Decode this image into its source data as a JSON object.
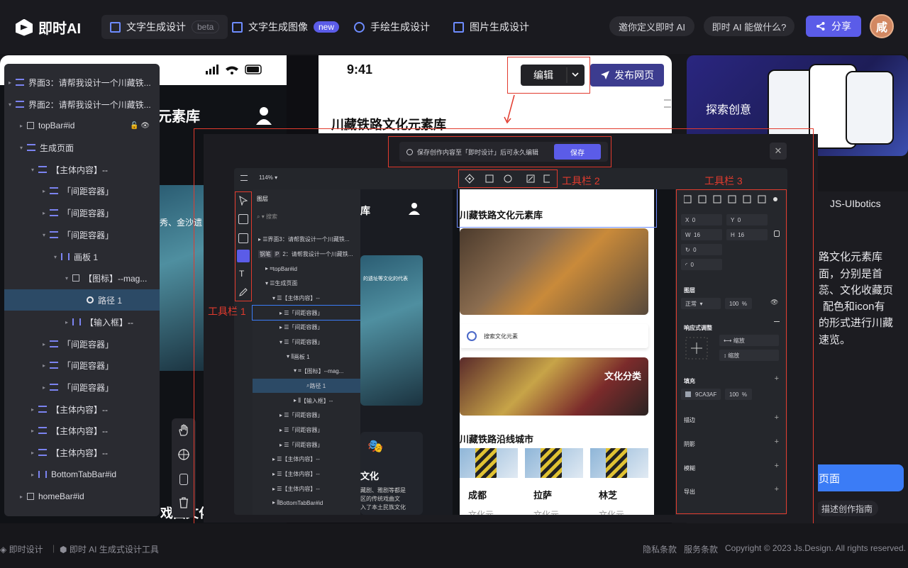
{
  "nav": {
    "brand": "即时AI",
    "tabs": [
      {
        "label": "文字生成设计",
        "badge": "beta"
      },
      {
        "label": "文字生成图像",
        "badge": "new"
      },
      {
        "label": "手绘生成设计"
      },
      {
        "label": "图片生成设计"
      }
    ],
    "invite": "邀你定义即时 AI",
    "what_can": "即时 AI 能做什么?",
    "share": "分享",
    "avatar": "咸"
  },
  "preview": {
    "time": "9:41",
    "title": "川藏铁路文化元素库",
    "title_partial": "元素库",
    "edit": "编辑",
    "publish": "发布网页",
    "photo_caption": "秀、金沙遗"
  },
  "tree": {
    "nodes": [
      {
        "label": "界面3：请帮我设计一个川藏铁..."
      },
      {
        "label": "界面2：请帮我设计一个川藏铁..."
      },
      {
        "label": "topBar#id"
      },
      {
        "label": "生成页面"
      },
      {
        "label": "【主体内容】--"
      },
      {
        "label": "「间距容器」"
      },
      {
        "label": "「间距容器」"
      },
      {
        "label": "「间距容器」"
      },
      {
        "label": "画板 1"
      },
      {
        "label": "【图标】--mag..."
      },
      {
        "label": "路径 1"
      },
      {
        "label": "【输入框】--"
      },
      {
        "label": "「间距容器」"
      },
      {
        "label": "「间距容器」"
      },
      {
        "label": "「间距容器」"
      },
      {
        "label": "【主体内容】--"
      },
      {
        "label": "【主体内容】--"
      },
      {
        "label": "【主体内容】--"
      },
      {
        "label": "BottomTabBar#id"
      },
      {
        "label": "homeBar#id"
      }
    ]
  },
  "annotations": {
    "toolbar1": "工具栏 1",
    "toolbar2": "工具栏 2",
    "toolbar3": "工具栏 3"
  },
  "dialog": {
    "notice": "保存创作内容至「即时设计」后可永久编辑",
    "save": "保存",
    "close": "✕",
    "zoom": "114%",
    "layers_tab": "图层",
    "search_placeholder": "搜索",
    "layers": [
      "界面3：请帮我设计一个川藏铁...",
      "2：请帮我设计一个川藏铁...",
      "topBar#id",
      "生成页面",
      "【主体内容】--",
      "「间距容器」",
      "「间距容器」",
      "「间距容器」",
      "画板 1",
      "【图标】--mag...",
      "路径 1",
      "【输入框】--",
      "「间距容器」",
      "「间距容器」",
      "「间距容器」",
      "【主体内容】--",
      "【主体内容】--",
      "【主体内容】--",
      "BottomTabBar#id"
    ],
    "layer_badges": [
      "钢笔",
      "P"
    ],
    "canvas": {
      "partial_title": "库",
      "dark_caption": "的遗址等文化的代表",
      "dark_heading": "文化",
      "dark_body": [
        "藏剧、雅剧等都是",
        "区的传统戏曲文",
        "入了本土民族文化"
      ],
      "title": "川藏铁路文化元素库",
      "search_label": "搜索文化元素",
      "culture_label": "文化分类",
      "cities_title": "川藏铁路沿线城市",
      "cities": [
        {
          "name": "成都",
          "sub": "文化元"
        },
        {
          "name": "拉萨",
          "sub": "文化元"
        },
        {
          "name": "林芝",
          "sub": "文化元"
        }
      ]
    },
    "props": {
      "x_label": "X",
      "x": "0",
      "y_label": "Y",
      "y": "0",
      "w_label": "W",
      "w": "16",
      "h_label": "H",
      "h": "16",
      "rotation": "0",
      "radius": "0",
      "layer_h": "图层",
      "blend": "正常",
      "opacity": "100",
      "percent": "%",
      "responsive_h": "响应式调整",
      "scale1": "缩放",
      "scale2": "缩放",
      "fill_h": "填充",
      "fill_color": "9CA3AF",
      "fill_opacity": "100",
      "stroke_h": "描边",
      "shadow_h": "阴影",
      "blur_h": "模糊",
      "export_h": "导出"
    }
  },
  "right": {
    "explore": "探索创意",
    "tab": "JS-UIbotics",
    "body_lines": [
      "路文化元素库",
      "面，分别是首",
      "蕊、文化收藏页",
      "配色和icon有",
      "的形式进行川藏",
      "速览。"
    ],
    "cta": "页面",
    "guide": "描述创作指南"
  },
  "bottom_left_texts": {
    "a": " ",
    "b": "戏曲文化"
  },
  "footer": {
    "brand1": "即时设计",
    "brand2": "即时 AI 生成式设计工具",
    "privacy": "隐私条款",
    "terms": "服务条款",
    "copyright": "Copyright © 2023 Js.Design. All rights reserved."
  },
  "colors": {
    "accent": "#5b5ce8",
    "annotation": "#e23b2e",
    "selection": "#2c4a66"
  }
}
